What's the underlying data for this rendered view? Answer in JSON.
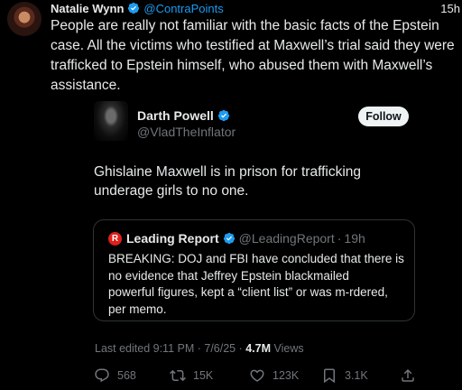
{
  "outer": {
    "author_name": "Natalie Wynn",
    "handle": "@ContraPoints",
    "time": "15h",
    "text_lines": [
      "People are really not familiar with the basic facts of the Epstein",
      "case. All the victims who testified at Maxwell’s trial said they were",
      "trafficked to Epstein himself, who abused them with Maxwell’s",
      "assistance."
    ]
  },
  "quoted": {
    "author_name": "Darth Powell",
    "handle": "@VladTheInflator",
    "follow_label": "Follow",
    "text_lines": [
      "Ghislaine Maxwell is in prison for trafficking",
      "underage girls to no one."
    ],
    "card": {
      "logo_letter": "R",
      "author_name": "Leading Report",
      "handle": "@LeadingReport",
      "dot": "·",
      "time": "19h",
      "text_lines": [
        "BREAKING: DOJ and FBI have concluded that there is",
        "no evidence that Jeffrey Epstein blackmailed",
        "powerful figures, kept a “client list” or was m-rdered,",
        "per memo."
      ]
    },
    "meta": {
      "edited": "Last edited 9:11 PM · 7/6/25 · ",
      "views_count": "4.7M",
      "views_label": " Views"
    },
    "actions": {
      "replies": "568",
      "reposts": "15K",
      "likes": "123K",
      "bookmarks": "3.1K"
    }
  },
  "colors": {
    "accent": "#1d9bf0",
    "background": "#000000",
    "text": "#e7e9ea",
    "muted": "#71767b",
    "logo_red": "#e0201b"
  },
  "icons": [
    "verified-badge-icon",
    "reply-icon",
    "repost-icon",
    "like-icon",
    "bookmark-icon",
    "share-icon"
  ]
}
